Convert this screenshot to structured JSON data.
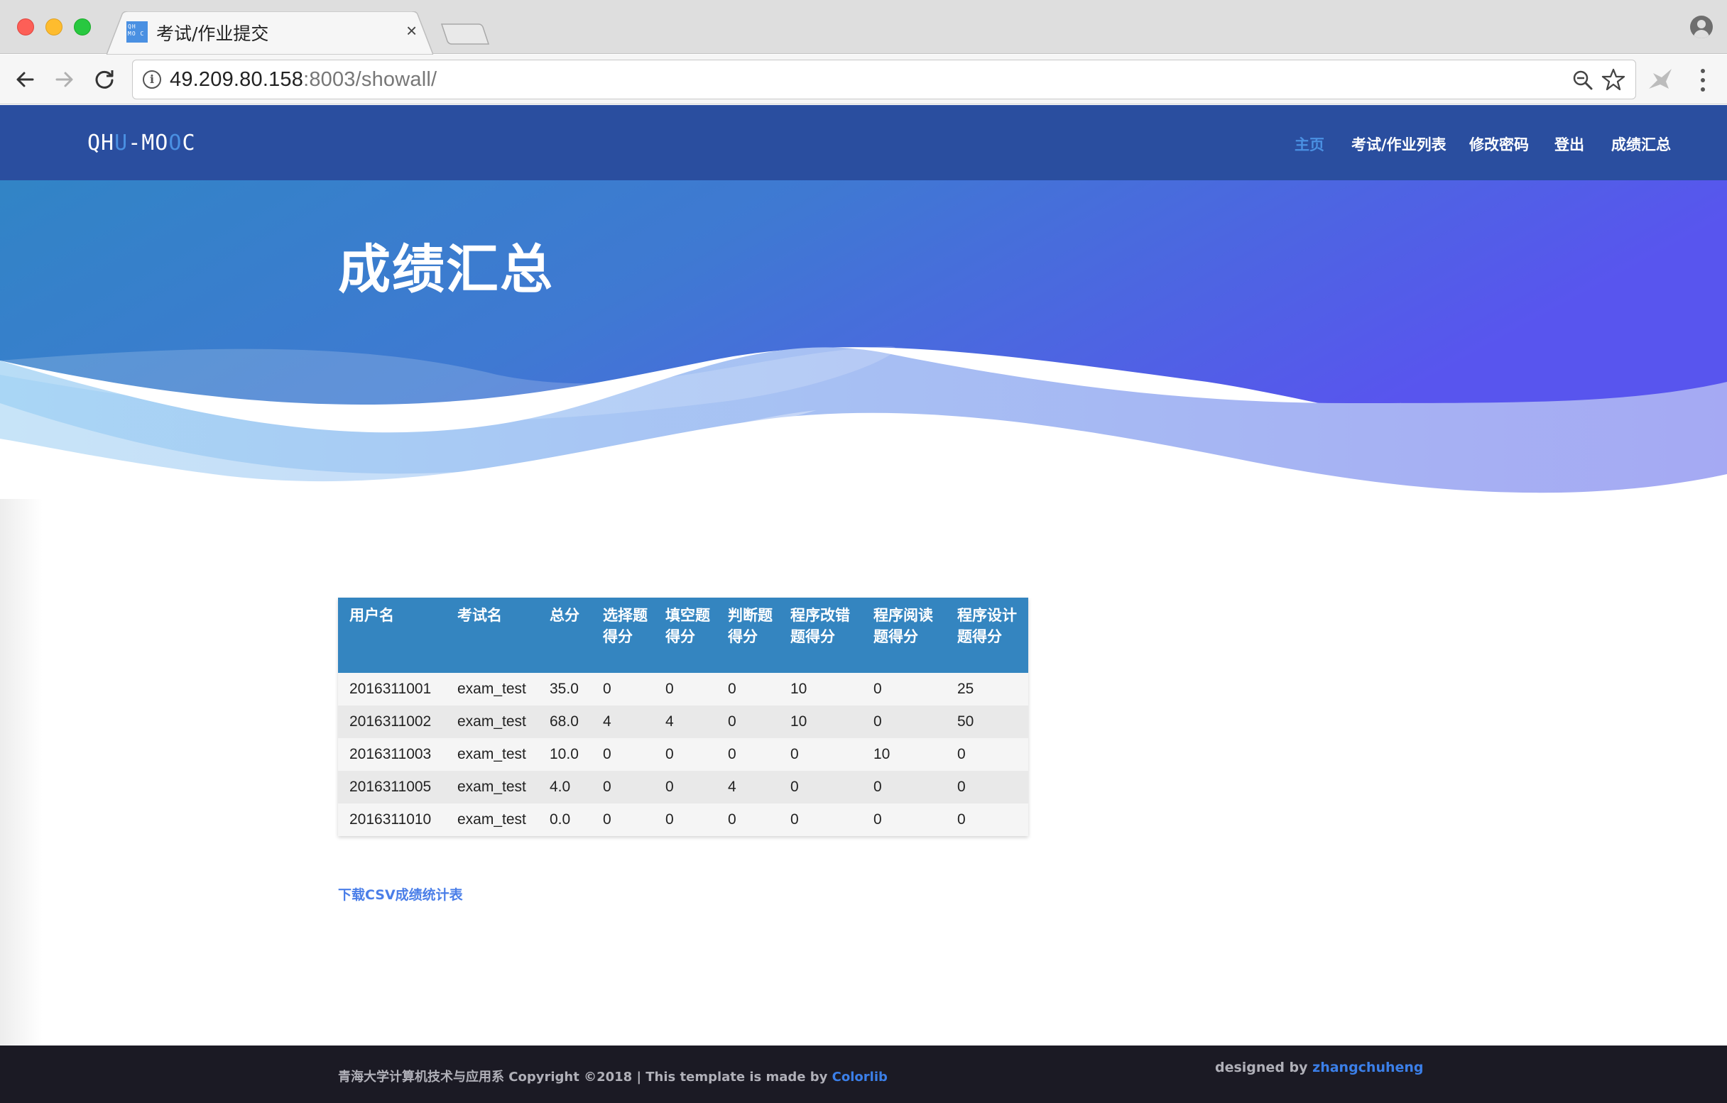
{
  "browser": {
    "tab_title": "考试/作业提交",
    "favicon_text": "QH MO C",
    "tab_close": "×",
    "url_host": "49.209.80.158",
    "url_rest": ":8003/showall/",
    "info_glyph": "i"
  },
  "site": {
    "logo": {
      "p1": "QH",
      "p2": "U",
      "p3": "-MO",
      "p4": "O",
      "p5": "C"
    },
    "nav": {
      "home": "主页",
      "exams": "考试/作业列表",
      "password": "修改密码",
      "logout": "登出",
      "grades": "成绩汇总"
    },
    "accent_color": "#4a90e2",
    "navbar_color": "#2a4e9f"
  },
  "hero": {
    "title": "成绩汇总"
  },
  "grades_table": {
    "headers": {
      "user": "用户名",
      "exam": "考试名",
      "total": "总分",
      "choice": "选择题得分",
      "fill": "填空题得分",
      "judge": "判断题得分",
      "fix": "程序改错题得分",
      "read": "程序阅读题得分",
      "design": "程序设计题得分"
    },
    "rows": [
      {
        "user": "2016311001",
        "exam": "exam_test",
        "total": "35.0",
        "choice": "0",
        "fill": "0",
        "judge": "0",
        "fix": "10",
        "read": "0",
        "design": "25"
      },
      {
        "user": "2016311002",
        "exam": "exam_test",
        "total": "68.0",
        "choice": "4",
        "fill": "4",
        "judge": "0",
        "fix": "10",
        "read": "0",
        "design": "50"
      },
      {
        "user": "2016311003",
        "exam": "exam_test",
        "total": "10.0",
        "choice": "0",
        "fill": "0",
        "judge": "0",
        "fix": "0",
        "read": "10",
        "design": "0"
      },
      {
        "user": "2016311005",
        "exam": "exam_test",
        "total": "4.0",
        "choice": "0",
        "fill": "0",
        "judge": "4",
        "fix": "0",
        "read": "0",
        "design": "0"
      },
      {
        "user": "2016311010",
        "exam": "exam_test",
        "total": "0.0",
        "choice": "0",
        "fill": "0",
        "judge": "0",
        "fix": "0",
        "read": "0",
        "design": "0"
      }
    ],
    "header_color": "#3485c0"
  },
  "download_link": "下载CSV成绩统计表",
  "footer": {
    "copyright": "青海大学计算机技术与应用系 Copyright ©2018 | This template is made by ",
    "template_link": "Colorlib",
    "designed_by": "designed by ",
    "designer_link": "zhangchuheng"
  }
}
